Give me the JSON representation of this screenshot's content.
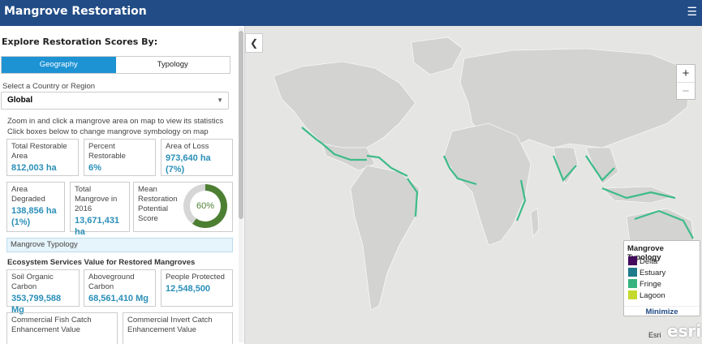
{
  "app": {
    "title": "Mangrove Restoration",
    "menu_icon": "hamburger-icon"
  },
  "panel": {
    "heading": "Explore Restoration Scores By:",
    "tabs": [
      {
        "label": "Geography",
        "active": true
      },
      {
        "label": "Typology",
        "active": false
      }
    ],
    "select_label": "Select a Country or Region",
    "select_value": "Global",
    "hint1": "Zoom in and click a mangrove area on map to view its statistics",
    "hint2": "Click boxes below to change mangrove symbology on map",
    "stats": {
      "total_restorable": {
        "label": "Total Restorable Area",
        "value": "812,003 ha"
      },
      "percent_restorable": {
        "label": "Percent Restorable",
        "value": "6%"
      },
      "area_of_loss": {
        "label": "Area of Loss",
        "value": "973,640 ha (7%)"
      },
      "area_degraded": {
        "label": "Area Degraded",
        "value": "138,856 ha (1%)"
      },
      "total_mangrove": {
        "label": "Total Mangrove in 2016",
        "value": "13,671,431 ha"
      },
      "mean_score": {
        "label": "Mean Restoration Potential Score",
        "value": "60%",
        "fraction": 0.6
      }
    },
    "typology_box": "Mangrove Typology",
    "eco_heading": "Ecosystem Services Value for Restored Mangroves",
    "eco": {
      "soil_carbon": {
        "label": "Soil Organic Carbon",
        "value": "353,799,588 Mg"
      },
      "above_carbon": {
        "label": "Aboveground Carbon",
        "value": "68,561,410 Mg"
      },
      "people": {
        "label": "People Protected",
        "value": "12,548,500"
      },
      "fish": {
        "label": "Commercial Fish Catch Enhancement Value"
      },
      "invert": {
        "label": "Commercial Invert Catch Enhancement Value"
      }
    }
  },
  "map": {
    "collapse_icon": "chevron-left-icon",
    "zoom_in": "+",
    "zoom_out": "−",
    "legend": {
      "title": "Mangrove Typology",
      "items": [
        {
          "label": "Delta",
          "color": "#440a5e"
        },
        {
          "label": "Estuary",
          "color": "#1f7a8c"
        },
        {
          "label": "Fringe",
          "color": "#36b37e"
        },
        {
          "label": "Lagoon",
          "color": "#c4d92e"
        }
      ],
      "minimize": "Minimize"
    },
    "attribution": "Esri",
    "logo": "esri",
    "colors": {
      "land": "#d3d3d2",
      "water": "#e5e5e4",
      "mangrove": "#3dbb88"
    }
  }
}
